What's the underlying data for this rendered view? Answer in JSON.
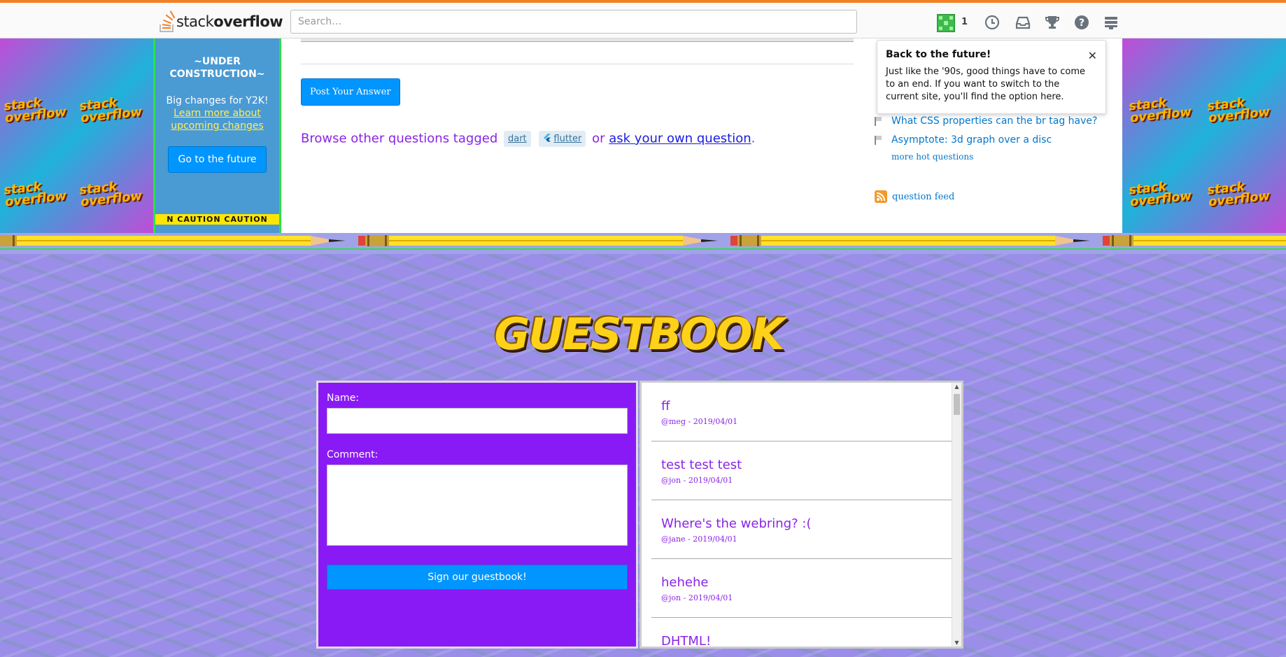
{
  "header": {
    "logo_text_light": "stack",
    "logo_text_bold": "overflow",
    "search_placeholder": "Search…",
    "reputation": "1"
  },
  "banners": {
    "tile_text_line1": "stack",
    "tile_text_line2": "overflow"
  },
  "sidebar": {
    "title": "~UNDER CONSTRUCTION~",
    "text": "Big changes for Y2K!",
    "link": "Learn more about upcoming changes",
    "button": "Go to the future",
    "caution": "N   CAUTION   CAUTION"
  },
  "main": {
    "post_button": "Post Your Answer",
    "browse_prefix": "Browse other questions tagged",
    "tags": [
      "dart",
      "flutter"
    ],
    "or_text": "or",
    "ask_link": "ask your own question",
    "period": "."
  },
  "hot_questions": {
    "items": [
      "What CSS properties can the br tag have?",
      "Asymptote: 3d graph over a disc"
    ],
    "more": "more hot questions",
    "feed": "question feed"
  },
  "popover": {
    "title": "Back to the future!",
    "body": "Just like the '90s, good things have to come to an end. If you want to switch to the current site, you'll find the option here.",
    "close": "✕"
  },
  "guestbook": {
    "title": "GUESTBOOK",
    "name_label": "Name:",
    "comment_label": "Comment:",
    "submit": "Sign our guestbook!",
    "entries": [
      {
        "comment": "ff",
        "meta": "@meg - 2019/04/01"
      },
      {
        "comment": "test test test",
        "meta": "@jon - 2019/04/01"
      },
      {
        "comment": "Where's the webring? :(",
        "meta": "@jane - 2019/04/01"
      },
      {
        "comment": "hehehe",
        "meta": "@jon - 2019/04/01"
      },
      {
        "comment": "DHTML!",
        "meta": ""
      }
    ]
  },
  "colors": {
    "accent": "#f48024",
    "primary_button": "#0095ff",
    "guestbook_purple": "#8a1af5",
    "text_purple": "#8a24e6",
    "border_green": "#2ee04a"
  }
}
